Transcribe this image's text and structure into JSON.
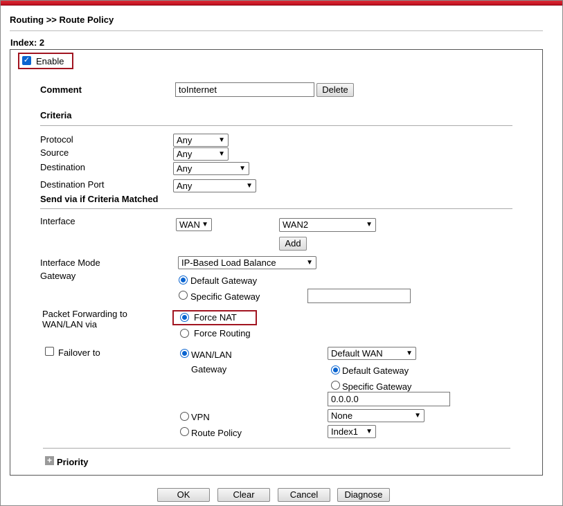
{
  "breadcrumb": "Routing >> Route Policy",
  "index_title": "Index: 2",
  "enable": {
    "label": "Enable",
    "checked": true
  },
  "comment": {
    "label": "Comment",
    "value": "toInternet",
    "delete_button": "Delete"
  },
  "criteria": {
    "heading": "Criteria",
    "protocol": {
      "label": "Protocol",
      "value": "Any"
    },
    "source": {
      "label": "Source",
      "value": "Any"
    },
    "destination": {
      "label": "Destination",
      "value": "Any"
    },
    "destination_port": {
      "label": "Destination Port",
      "value": "Any"
    }
  },
  "send_via": {
    "heading": "Send via if Criteria Matched",
    "interface": {
      "label": "Interface",
      "type_value": "WAN",
      "port_value": "WAN2",
      "add_button": "Add"
    },
    "interface_mode": {
      "label": "Interface Mode",
      "value": "IP-Based Load Balance"
    },
    "gateway": {
      "label": "Gateway",
      "default_label": "Default Gateway",
      "specific_label": "Specific Gateway",
      "specific_value": "",
      "selected": "default"
    },
    "packet_forwarding": {
      "label_line1": "Packet Forwarding to",
      "label_line2": "WAN/LAN via",
      "force_nat": "Force NAT",
      "force_routing": "Force Routing",
      "selected": "force_nat"
    },
    "failover": {
      "label": "Failover to",
      "checked": false,
      "wan_lan_label": "WAN/LAN",
      "gateway_label": "Gateway",
      "wan_value": "Default WAN",
      "default_gateway_label": "Default Gateway",
      "specific_gateway_label": "Specific Gateway",
      "gateway_ip": "0.0.0.0",
      "vpn_label": "VPN",
      "vpn_value": "None",
      "route_policy_label": "Route Policy",
      "route_policy_value": "Index1",
      "selected": "wan_lan",
      "gateway_selected": "default"
    }
  },
  "priority": {
    "label": "Priority"
  },
  "buttons": {
    "ok": "OK",
    "clear": "Clear",
    "cancel": "Cancel",
    "diagnose": "Diagnose"
  },
  "colors": {
    "highlight": "#a11420",
    "accent": "#0a64d0",
    "top_bar": "#d01e2a"
  }
}
